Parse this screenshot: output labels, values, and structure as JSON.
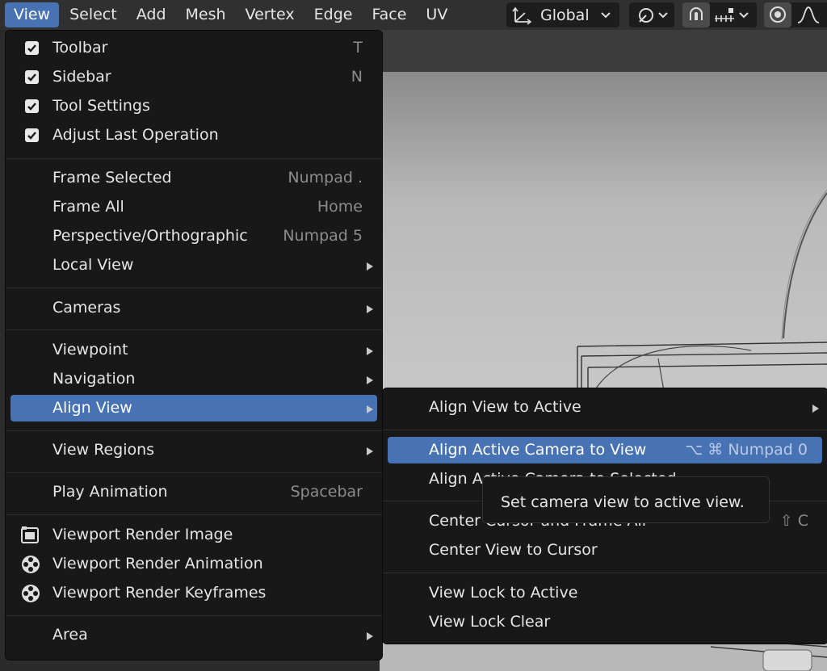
{
  "header": {
    "menus": [
      "View",
      "Select",
      "Add",
      "Mesh",
      "Vertex",
      "Edge",
      "Face",
      "UV"
    ],
    "orientation_label": "Global"
  },
  "view_menu": {
    "toggles": [
      {
        "label": "Toolbar",
        "shortcut": "T",
        "checked": true
      },
      {
        "label": "Sidebar",
        "shortcut": "N",
        "checked": true
      },
      {
        "label": "Tool Settings",
        "shortcut": "",
        "checked": true
      },
      {
        "label": "Adjust Last Operation",
        "shortcut": "",
        "checked": true
      }
    ],
    "frame_selected": {
      "label": "Frame Selected",
      "shortcut": "Numpad ."
    },
    "frame_all": {
      "label": "Frame All",
      "shortcut": "Home"
    },
    "perspective": {
      "label": "Perspective/Orthographic",
      "shortcut": "Numpad 5"
    },
    "local_view": {
      "label": "Local View"
    },
    "cameras": {
      "label": "Cameras"
    },
    "viewpoint": {
      "label": "Viewpoint"
    },
    "navigation": {
      "label": "Navigation"
    },
    "align_view": {
      "label": "Align View"
    },
    "view_regions": {
      "label": "View Regions"
    },
    "play_animation": {
      "label": "Play Animation",
      "shortcut": "Spacebar"
    },
    "render_image": {
      "label": "Viewport Render Image",
      "icon": "render-still-icon"
    },
    "render_animation": {
      "label": "Viewport Render Animation",
      "icon": "film-reel-icon"
    },
    "render_keyframes": {
      "label": "Viewport Render Keyframes",
      "icon": "film-reel-icon"
    },
    "area": {
      "label": "Area"
    }
  },
  "align_submenu": {
    "align_to_active": {
      "label": "Align View to Active"
    },
    "align_camera": {
      "label": "Align Active Camera to View",
      "shortcut": "⌥ ⌘ Numpad 0"
    },
    "align_camera_selected": {
      "label": "Align Active Camera to Selected"
    },
    "center_cursor": {
      "label": "Center Cursor and Frame All",
      "shortcut": "⇧ C"
    },
    "center_view": {
      "label": "Center View to Cursor"
    },
    "lock_active": {
      "label": "View Lock to Active"
    },
    "lock_clear": {
      "label": "View Lock Clear"
    }
  },
  "tooltip": {
    "text": "Set camera view to active view."
  },
  "colors": {
    "highlight": "#4772b3",
    "menu_bg": "#181818",
    "header_bg": "#303030"
  }
}
